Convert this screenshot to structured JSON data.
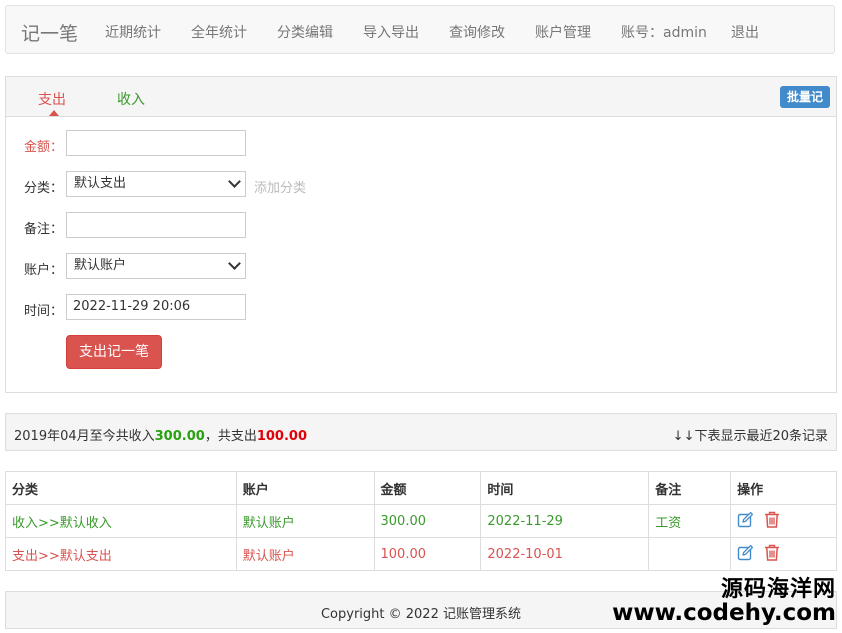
{
  "navbar": {
    "brand": "记一笔",
    "items": [
      "近期统计",
      "全年统计",
      "分类编辑",
      "导入导出",
      "查询修改",
      "账户管理",
      "账号：admin",
      "退出"
    ]
  },
  "tabs": {
    "expense": "支出",
    "income": "收入"
  },
  "batch_button": "批量记",
  "form": {
    "amount_label": "金额：",
    "amount_value": "",
    "category_label": "分类：",
    "category_selected": "默认支出",
    "add_category": "添加分类",
    "note_label": "备注：",
    "note_value": "",
    "account_label": "账户：",
    "account_selected": "默认账户",
    "time_label": "时间：",
    "time_value": "2022-11-29 20:06",
    "submit": "支出记一笔"
  },
  "summary": {
    "prefix": "2019年04月至今共收入",
    "income_total": "300.00",
    "middle": "，共支出",
    "expense_total": "100.00",
    "right": "↓↓下表显示最近20条记录"
  },
  "table": {
    "headers": [
      "分类",
      "账户",
      "金额",
      "时间",
      "备注",
      "操作"
    ],
    "rows": [
      {
        "category": "收入>>默认收入",
        "account": "默认账户",
        "amount": "300.00",
        "time": "2022-11-29",
        "note": "工资",
        "type": "income"
      },
      {
        "category": "支出>>默认支出",
        "account": "默认账户",
        "amount": "100.00",
        "time": "2022-10-01",
        "note": "",
        "type": "expense"
      }
    ]
  },
  "footer": {
    "copyright": "Copyright © 2022 记账管理系统"
  },
  "watermark": {
    "line1": "源码海洋网",
    "line2": "www.codehy.com"
  },
  "icons": {
    "edit": "edit-icon",
    "delete": "trash-icon"
  },
  "colors": {
    "expense": "#d9534f",
    "income": "#3a9a2c",
    "primary": "#428bca"
  }
}
